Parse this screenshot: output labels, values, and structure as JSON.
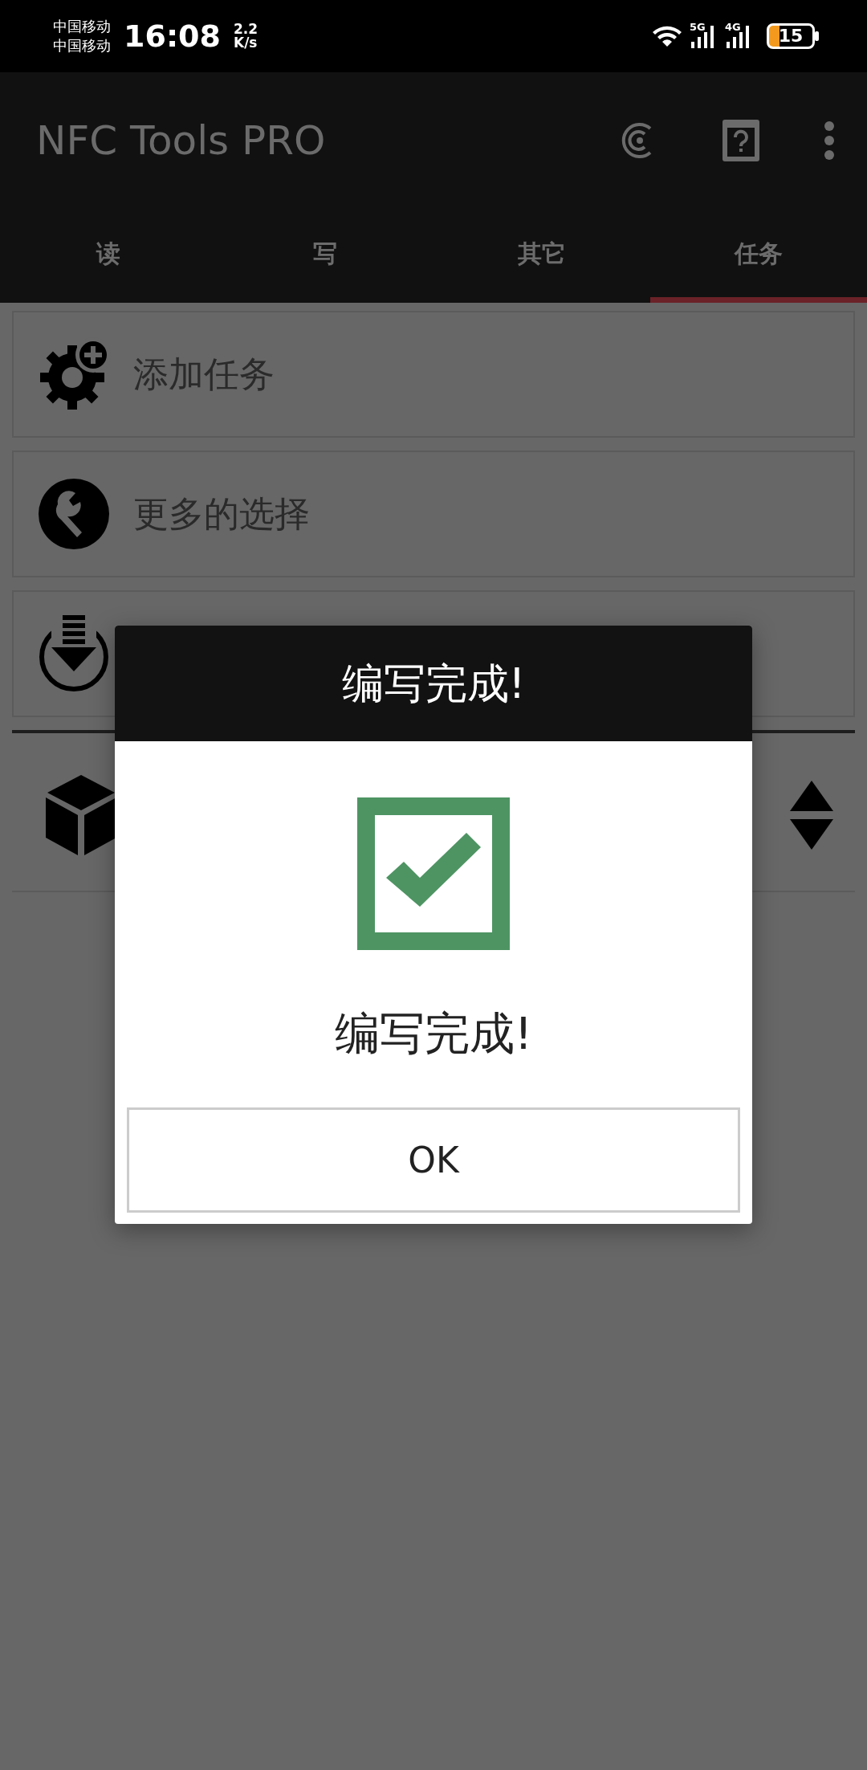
{
  "status_bar": {
    "carriers": [
      "中国移动",
      "中国移动"
    ],
    "time": "16:08",
    "speed_value": "2.2",
    "speed_unit": "K/s",
    "network_labels": [
      "5G",
      "4G"
    ],
    "battery": "15"
  },
  "app_bar": {
    "title": "NFC Tools PRO"
  },
  "tabs": [
    {
      "label": "读",
      "selected": false
    },
    {
      "label": "写",
      "selected": false
    },
    {
      "label": "其它",
      "selected": false
    },
    {
      "label": "任务",
      "selected": true
    }
  ],
  "actions": [
    {
      "label": "添加任务"
    },
    {
      "label": "更多的选择"
    }
  ],
  "dialog": {
    "title": "编写完成!",
    "message": "编写完成!",
    "button": "OK"
  }
}
